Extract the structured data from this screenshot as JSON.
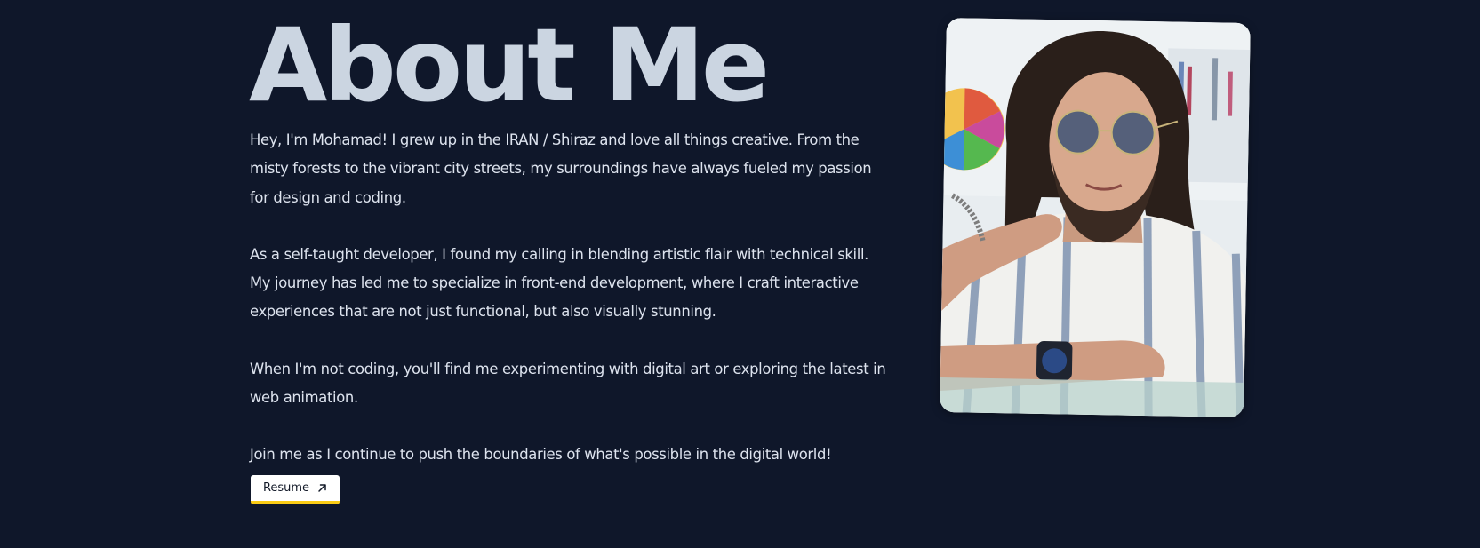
{
  "about": {
    "title": "About Me",
    "paragraphs": [
      "Hey, I'm Mohamad! I grew up in the IRAN / Shiraz and love all things creative. From the misty forests to the vibrant city streets, my surroundings have always fueled my passion for design and coding.",
      "As a self-taught developer, I found my calling in blending artistic flair with technical skill. My journey has led me to specialize in front-end development, where I craft interactive experiences that are not just functional, but also visually stunning.",
      "When I'm not coding, you'll find me experimenting with digital art or exploring the latest in web animation.",
      "Join me as I continue to push the boundaries of what's possible in the digital world!"
    ],
    "resume_label": "Resume",
    "resume_icon": "arrow-up-right-icon",
    "photo_icon": "portrait-photo"
  },
  "colors": {
    "background": "#0f172a",
    "heading": "#cbd5e1",
    "text": "#dde3ee",
    "button_bg": "#ffffff",
    "button_accent": "#facc15"
  }
}
